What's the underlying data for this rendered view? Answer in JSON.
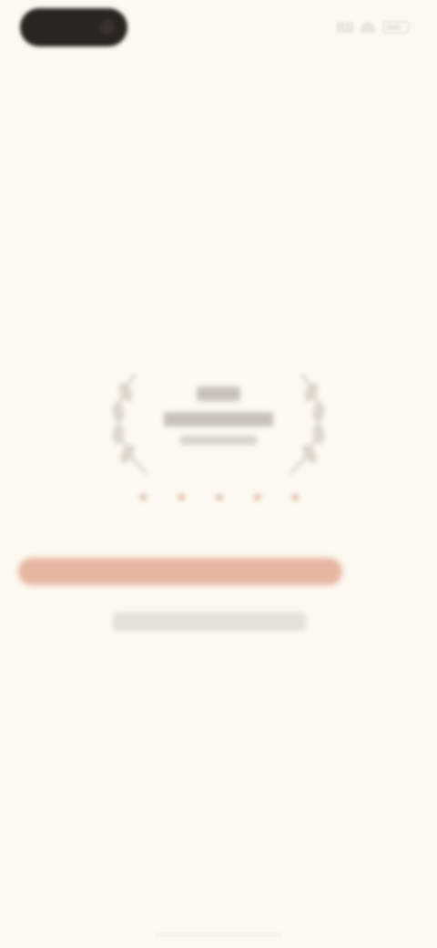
{
  "status_bar": {
    "camera_pill_label": "",
    "icons": [
      "signal-icon",
      "wifi-icon",
      "battery-icon"
    ]
  },
  "emblem": {
    "title": "",
    "subtitle": "",
    "caption": "",
    "icon": "laurel-wreath-icon"
  },
  "rating": {
    "stars": 5,
    "icon": "star-icon"
  },
  "actions": {
    "primary_label": "",
    "secondary_label": ""
  },
  "colors": {
    "background": "#fdf9f1",
    "accent": "#e6b6a0",
    "pill": "#2b2522",
    "star": "#e3c7b6",
    "muted": "#bdb7b0"
  }
}
